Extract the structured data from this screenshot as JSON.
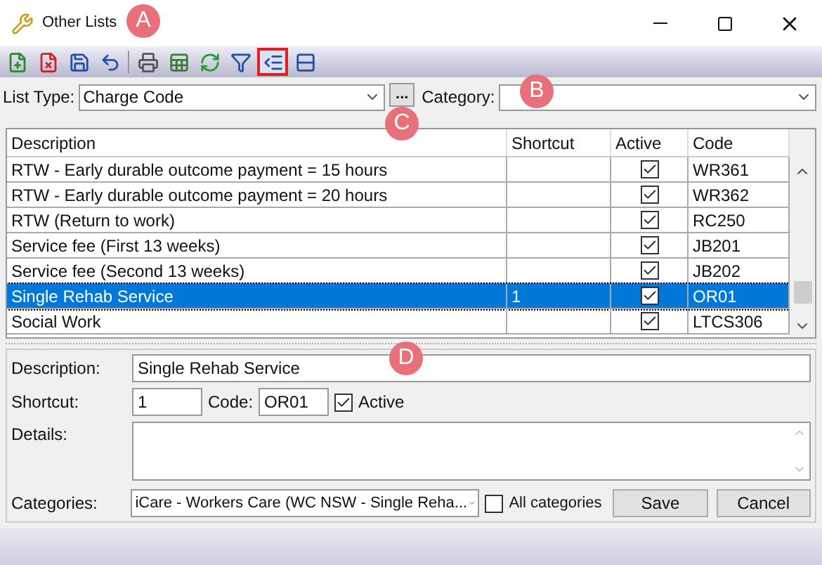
{
  "window": {
    "title": "Other Lists"
  },
  "toolbar": [
    {
      "kind": "add",
      "highlighted": false
    },
    {
      "kind": "delete",
      "highlighted": false
    },
    {
      "kind": "save",
      "highlighted": false
    },
    {
      "kind": "undo",
      "highlighted": false
    },
    {
      "kind": "print",
      "highlighted": false
    },
    {
      "kind": "export",
      "highlighted": false
    },
    {
      "kind": "refresh",
      "highlighted": false
    },
    {
      "kind": "filter",
      "highlighted": false
    },
    {
      "kind": "detail",
      "highlighted": true
    },
    {
      "kind": "split",
      "highlighted": false
    }
  ],
  "filters": {
    "list_type_label": "List Type:",
    "list_type_value": "Charge Code",
    "browse_button": "...",
    "category_label": "Category:"
  },
  "table": {
    "columns": [
      "Description",
      "Shortcut",
      "Active",
      "Code"
    ],
    "rows": [
      {
        "description": "RTW - Early durable outcome payment = 15 hours",
        "shortcut": "",
        "active": true,
        "code": "WR361",
        "selected": false
      },
      {
        "description": "RTW - Early durable outcome payment = 20 hours",
        "shortcut": "",
        "active": true,
        "code": "WR362",
        "selected": false
      },
      {
        "description": "RTW (Return to work)",
        "shortcut": "",
        "active": true,
        "code": "RC250",
        "selected": false
      },
      {
        "description": "Service fee (First 13 weeks)",
        "shortcut": "",
        "active": true,
        "code": "JB201",
        "selected": false
      },
      {
        "description": "Service fee (Second 13 weeks)",
        "shortcut": "",
        "active": true,
        "code": "JB202",
        "selected": false
      },
      {
        "description": "Single Rehab Service",
        "shortcut": "1",
        "active": true,
        "code": "OR01",
        "selected": true
      },
      {
        "description": "Social Work",
        "shortcut": "",
        "active": true,
        "code": "LTCS306",
        "selected": false
      }
    ]
  },
  "details": {
    "description_label": "Description:",
    "description_value": "Single Rehab Service",
    "shortcut_label": "Shortcut:",
    "shortcut_value": "1",
    "code_label": "Code:",
    "code_value": "OR01",
    "active_label": "Active",
    "active": true,
    "details_label": "Details:",
    "categories_label": "Categories:",
    "categories_value": "iCare - Workers Care (WC NSW - Single Reha...",
    "all_categories_label": "All categories",
    "all_categories": false,
    "buttons": [
      "Save",
      "Cancel"
    ]
  },
  "callouts": [
    {
      "label": "A"
    },
    {
      "label": "B"
    },
    {
      "label": "C"
    },
    {
      "label": "D"
    }
  ]
}
